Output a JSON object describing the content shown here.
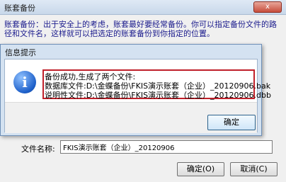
{
  "background_dialog": {
    "title": "账套备份",
    "close_label": "x",
    "description": "账套备份：出于安全上的考虑，账套最好要经常备份。你可以指定备份文件的路径和文件名，这样就可以把选定的账套备份到你指定的位置。",
    "filename_label": "文件名称:",
    "filename_value": "FKIS演示账套（企业）_20120906",
    "ok_label": "确定(O)",
    "cancel_label": "取消(C)"
  },
  "message_dialog": {
    "title": "信息提示",
    "icon": "info-icon",
    "lines": [
      "备份成功,生成了两个文件:",
      "数据库文件:D:\\金蝶备份\\FKIS演示账套（企业）_20120906.bak",
      "说明性文件:D:\\金蝶备份\\FKIS演示账套（企业）_20120906.dbb"
    ],
    "ok_label": "确定",
    "highlight_color": "#c0202a"
  }
}
